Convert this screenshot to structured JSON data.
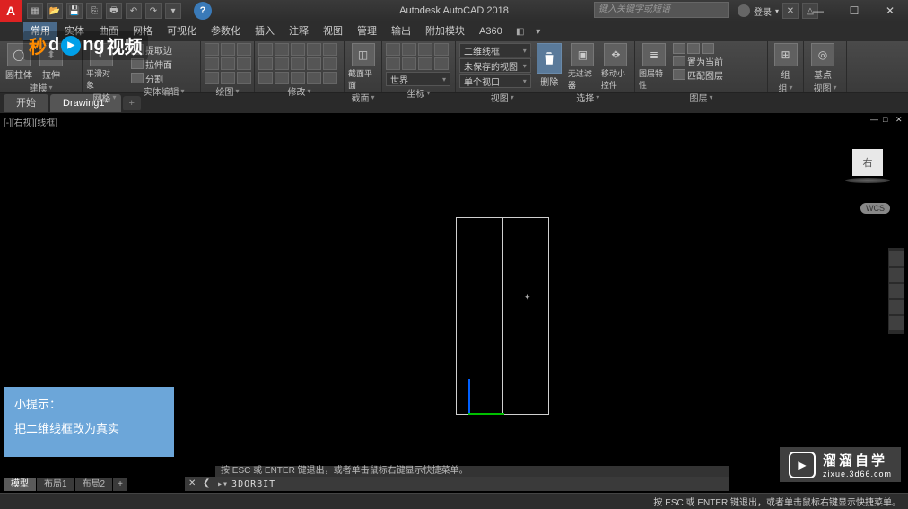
{
  "app": {
    "logo_letter": "A",
    "title": "Autodesk AutoCAD 2018",
    "search_placeholder": "键入关键字或短语",
    "user_label": "登录"
  },
  "window_controls": {
    "min": "—",
    "max": "☐",
    "close": "✕"
  },
  "menu": {
    "items": [
      "常用",
      "实体",
      "曲面",
      "网格",
      "可视化",
      "参数化",
      "插入",
      "注释",
      "视图",
      "管理",
      "输出",
      "附加模块",
      "A360"
    ],
    "active_index": 0
  },
  "ribbon": {
    "panels": [
      {
        "name": "建模",
        "big": [
          {
            "label": "圆柱体",
            "icon": "cylinder"
          },
          {
            "label": "拉伸",
            "icon": "extrude"
          }
        ],
        "small": []
      },
      {
        "name": "网格",
        "big": [
          {
            "label": "平滑对象",
            "icon": "smooth"
          }
        ]
      },
      {
        "name": "实体编辑",
        "small_rows": [
          [
            "提取边",
            "▾"
          ],
          [
            "拉伸面",
            "▾"
          ],
          [
            "分割",
            "▾"
          ]
        ]
      },
      {
        "name": "绘图",
        "icon_count": 9
      },
      {
        "name": "修改",
        "icon_count": 15
      },
      {
        "name": "截面",
        "big": [
          {
            "label": "截面平面",
            "icon": "section"
          }
        ]
      },
      {
        "name": "坐标",
        "icon_count": 9,
        "dropdown": "世界"
      },
      {
        "name": "视图",
        "dropdowns": [
          "二维线框",
          "未保存的视图",
          "单个视口"
        ],
        "big_delete": {
          "label": "删除",
          "highlight": true
        },
        "big": [
          {
            "label": "无过滤器",
            "icon": "cube"
          },
          {
            "label": "移动小控件",
            "icon": "gizmo"
          }
        ],
        "sub_label": "选择"
      },
      {
        "name": "图层",
        "big": [
          {
            "label": "图层特性",
            "icon": "layers"
          }
        ],
        "small_rows": [
          [
            "置为当前"
          ],
          [
            "匹配图层"
          ]
        ],
        "icon_count": 6
      },
      {
        "name": "组",
        "big": [
          {
            "label": "组",
            "icon": "group"
          }
        ]
      },
      {
        "name": "视图",
        "big": [
          {
            "label": "基点",
            "icon": "base"
          }
        ]
      }
    ]
  },
  "file_tabs": {
    "start": "开始",
    "items": [
      "Drawing1*"
    ],
    "active_index": 0
  },
  "viewport": {
    "label": "[-][右视][线框]",
    "viewcube_face": "右",
    "wcs_label": "WCS"
  },
  "tip": {
    "title": "小提示：",
    "body": "把二维线框改为真实"
  },
  "command": {
    "hint": "按 ESC 或 ENTER 键退出，或者单击鼠标右键显示快捷菜单。",
    "prompt": "▸▾",
    "text": "3DORBIT"
  },
  "layout_tabs": {
    "items": [
      "模型",
      "布局1",
      "布局2"
    ],
    "active_index": 0
  },
  "status": {
    "right_msg": "按 ESC 或 ENTER 键退出，或者单击鼠标右键显示快捷菜单。"
  },
  "watermark_top": {
    "prefix_orange": "秒",
    "suffix": "视频"
  },
  "watermark_bottom": {
    "line1": "溜溜自学",
    "line2": "zixue.3d66.com"
  }
}
